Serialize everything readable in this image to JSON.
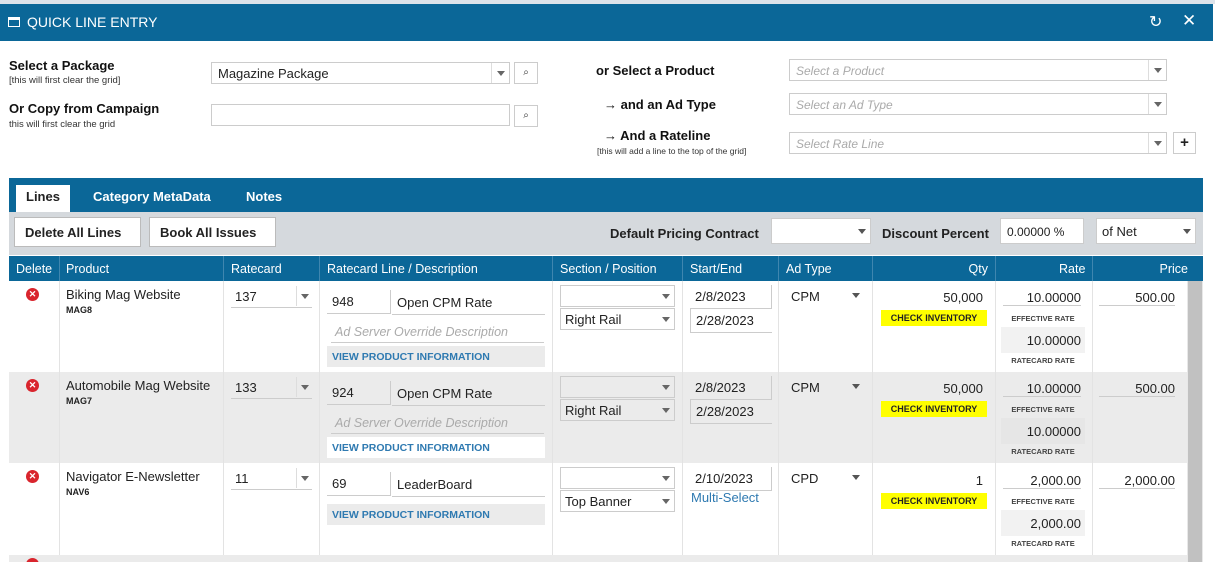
{
  "window": {
    "title": "QUICK LINE ENTRY",
    "refresh_icon": "↻",
    "close_icon": "✕"
  },
  "form": {
    "package_label": "Select a Package",
    "package_hint": "[this will first clear the grid]",
    "package_value": "Magazine Package",
    "copy_label": "Or Copy from Campaign",
    "copy_hint": "this will first clear the grid",
    "copy_value": "",
    "product_label": "or Select a Product",
    "product_placeholder": "Select a Product",
    "adtype_label": "→ and an Ad Type",
    "adtype_placeholder": "Select an Ad Type",
    "rateline_label": "→ And a Rateline",
    "rateline_hint": "[this will add a line to the top of the grid]",
    "rateline_placeholder": "Select Rate Line",
    "add_label": "+"
  },
  "tabs": [
    {
      "label": "Lines"
    },
    {
      "label": "Category MetaData"
    },
    {
      "label": "Notes"
    }
  ],
  "toolbar": {
    "delete_all": "Delete All Lines",
    "book_all": "Book All Issues",
    "pricing_label": "Default Pricing Contract",
    "pricing_value": "",
    "discount_label": "Discount Percent",
    "discount_value": "0.00000 %",
    "net_value": "of Net"
  },
  "columns": [
    "Delete",
    "Product",
    "Ratecard",
    "Ratecard Line / Description",
    "Section / Position",
    "Start/End",
    "Ad Type",
    "Qty",
    "Rate",
    "Price"
  ],
  "common": {
    "override_placeholder": "Ad Server Override Description",
    "view_product": "VIEW PRODUCT INFORMATION",
    "check_inventory": "CHECK INVENTORY",
    "effective_rate": "EFFECTIVE RATE",
    "ratecard_rate": "RATECARD RATE",
    "delete_icon": "x-circle-icon"
  },
  "rows": [
    {
      "product": "Biking Mag Website",
      "code": "MAG8",
      "ratecard": "137",
      "line_num": "948",
      "line_desc": "Open CPM Rate",
      "position": "Right Rail",
      "start": "2/8/2023",
      "end": "2/28/2023",
      "adtype": "CPM",
      "qty": "50,000",
      "rate": "10.00000",
      "ratecard_rate": "10.00000",
      "price": "500.00"
    },
    {
      "product": "Automobile Mag Website",
      "code": "MAG7",
      "ratecard": "133",
      "line_num": "924",
      "line_desc": "Open CPM Rate",
      "position": "Right Rail",
      "start": "2/8/2023",
      "end": "2/28/2023",
      "adtype": "CPM",
      "qty": "50,000",
      "rate": "10.00000",
      "ratecard_rate": "10.00000",
      "price": "500.00"
    },
    {
      "product": "Navigator E-Newsletter",
      "code": "NAV6",
      "ratecard": "11",
      "line_num": "69",
      "line_desc": "LeaderBoard",
      "position": "Top Banner",
      "start": "2/10/2023",
      "multi": "Multi-Select",
      "adtype": "CPD",
      "qty": "1",
      "rate": "2,000.00",
      "ratecard_rate": "2,000.00",
      "price": "2,000.00"
    }
  ]
}
